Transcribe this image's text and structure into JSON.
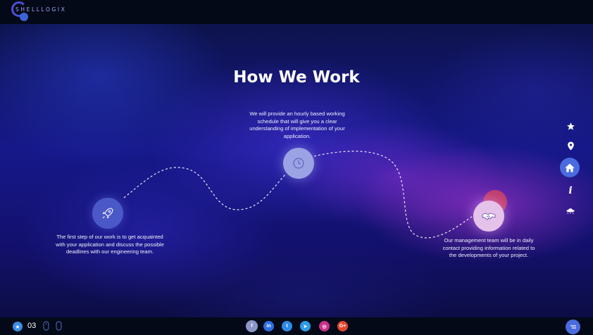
{
  "brand": {
    "logo_text": "SHELLLOGIX"
  },
  "page": {
    "title": "How We Work"
  },
  "steps": [
    {
      "icon": "rocket-icon",
      "text": "The first step of our work is to get acquainted with your application and discuss the possible deadlines with our engineering team."
    },
    {
      "icon": "clock-icon",
      "text": "We will provide an hourly based working schedule that will give you a clear understanding of implementation of your application."
    },
    {
      "icon": "handshake-icon",
      "text": "Our management team will be in daily contact providing information related to the developments of your project."
    }
  ],
  "sidenav": [
    "star-icon",
    "location-pin-icon",
    "home-icon",
    "info-icon",
    "ufo-icon"
  ],
  "sidenav_info_glyph": "i",
  "footer": {
    "slide_number": "03",
    "social": [
      {
        "name": "facebook",
        "glyph": "f",
        "color": "#8c96c8"
      },
      {
        "name": "linkedin",
        "glyph": "in",
        "color": "#2e6ee0"
      },
      {
        "name": "twitter",
        "glyph": "t",
        "color": "#2e8be6"
      },
      {
        "name": "telegram",
        "glyph": "➤",
        "color": "#2e9be6"
      },
      {
        "name": "instagram",
        "glyph": "◎",
        "color": "#c9308a"
      },
      {
        "name": "google-plus",
        "glyph": "G+",
        "color": "#e0452f"
      }
    ]
  },
  "colors": {
    "accent": "#4a6be0",
    "background": "#16188a",
    "bar": "#040918"
  }
}
